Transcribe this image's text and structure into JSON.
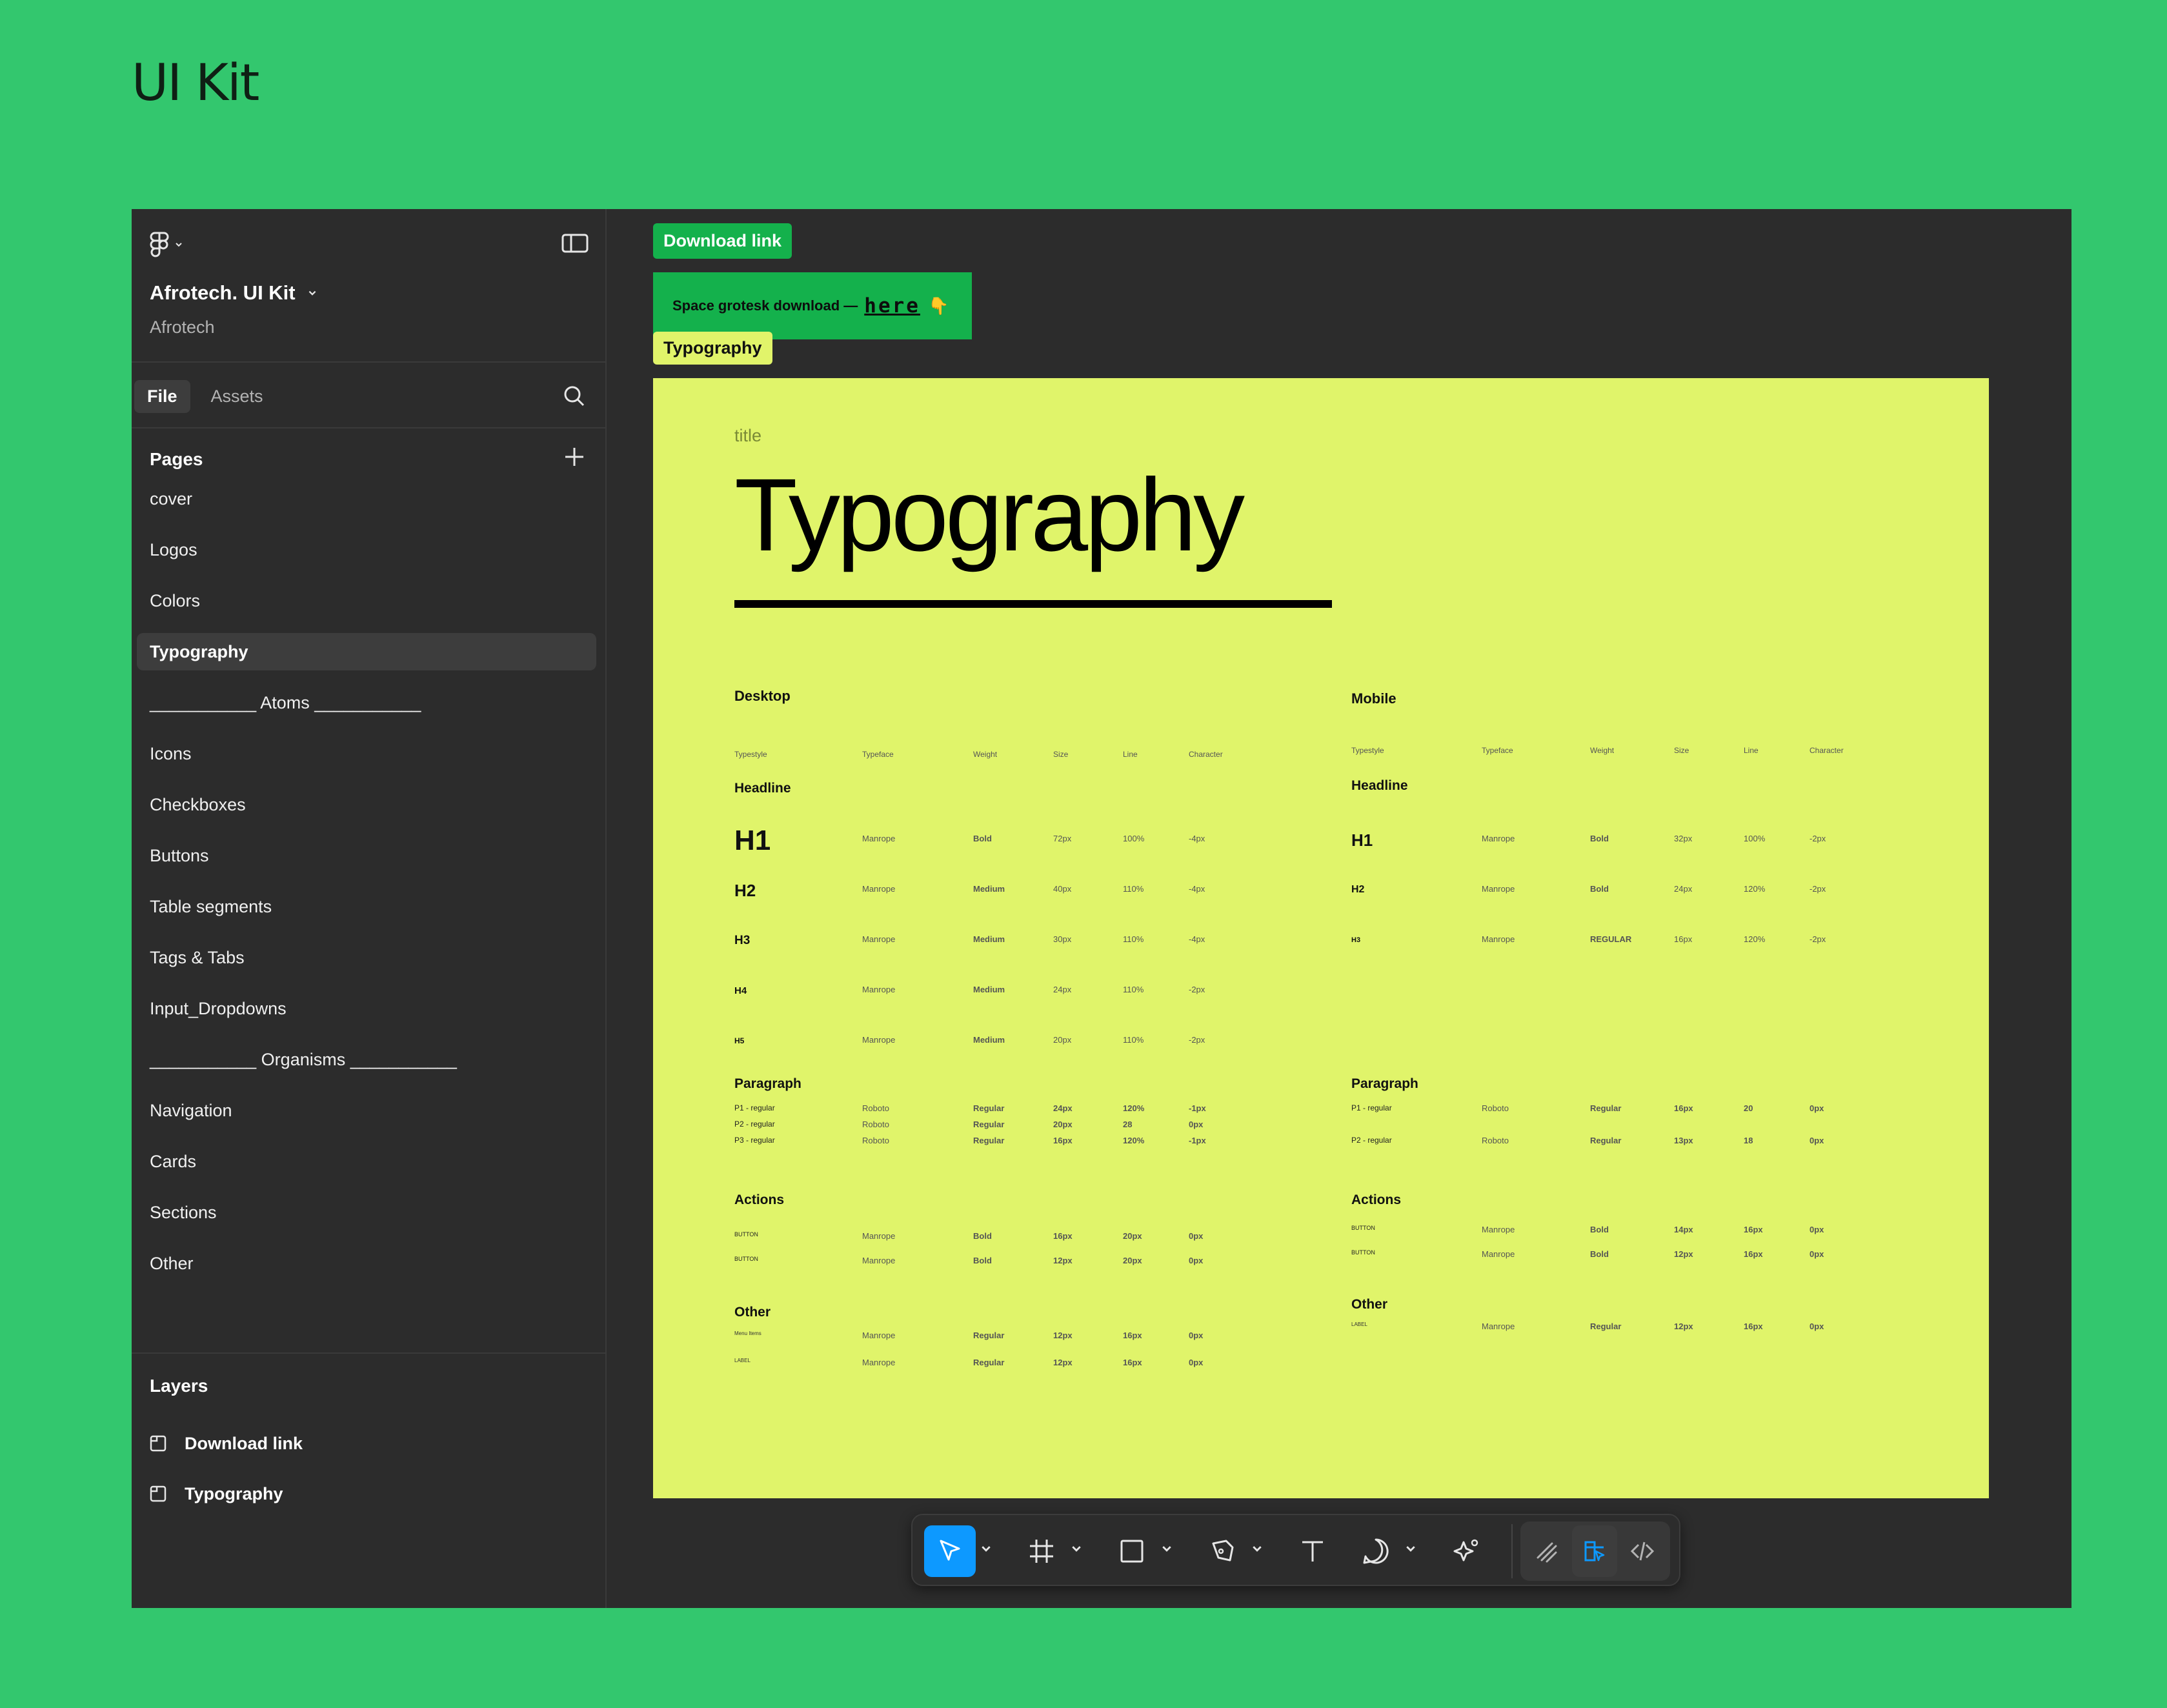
{
  "page_title": "UI Kit",
  "sidebar": {
    "file_name": "Afrotech. UI Kit",
    "team": "Afrotech",
    "tabs": [
      "File",
      "Assets"
    ],
    "pages_heading": "Pages",
    "pages": [
      "cover",
      "Logos",
      "Colors",
      "Typography",
      "___________ Atoms ___________",
      "Icons",
      "Checkboxes",
      "Buttons",
      "Table segments",
      "Tags & Tabs",
      "Input_Dropdowns",
      "___________ Organisms ___________",
      "Navigation",
      "Cards",
      "Sections",
      "Other"
    ],
    "active_page": "Typography",
    "layers_heading": "Layers",
    "layers": [
      "Download link",
      "Typography"
    ]
  },
  "canvas": {
    "download_tag": "Download link",
    "banner_text": "Space grotesk download —",
    "banner_link": "here",
    "banner_emoji": "👇",
    "typography_tag": "Typography"
  },
  "artboard": {
    "label": "title",
    "title": "Typography",
    "desktop": {
      "heading": "Desktop",
      "columns": [
        "Typestyle",
        "Typeface",
        "Weight",
        "Size",
        "Line",
        "Character"
      ],
      "headline_heading": "Headline",
      "headline_rows": [
        [
          "H1",
          "Manrope",
          "Bold",
          "72px",
          "100%",
          "-4px"
        ],
        [
          "H2",
          "Manrope",
          "Medium",
          "40px",
          "110%",
          "-4px"
        ],
        [
          "H3",
          "Manrope",
          "Medium",
          "30px",
          "110%",
          "-4px"
        ],
        [
          "H4",
          "Manrope",
          "Medium",
          "24px",
          "110%",
          "-2px"
        ],
        [
          "H5",
          "Manrope",
          "Medium",
          "20px",
          "110%",
          "-2px"
        ]
      ],
      "paragraph_heading": "Paragraph",
      "paragraph_rows": [
        [
          "P1 - regular",
          "Roboto",
          "Regular",
          "24px",
          "120%",
          "-1px"
        ],
        [
          "P2 - regular",
          "Roboto",
          "Regular",
          "20px",
          "28",
          "0px"
        ],
        [
          "P3 - regular",
          "Roboto",
          "Regular",
          "16px",
          "120%",
          "-1px"
        ]
      ],
      "actions_heading": "Actions",
      "actions_rows": [
        [
          "BUTTON",
          "Manrope",
          "Bold",
          "16px",
          "20px",
          "0px"
        ],
        [
          "BUTTON",
          "Manrope",
          "Bold",
          "12px",
          "20px",
          "0px"
        ]
      ],
      "other_heading": "Other",
      "other_rows": [
        [
          "Menu Items",
          "Manrope",
          "Regular",
          "12px",
          "16px",
          "0px"
        ],
        [
          "LABEL",
          "Manrope",
          "Regular",
          "12px",
          "16px",
          "0px"
        ]
      ]
    },
    "mobile": {
      "heading": "Mobile",
      "columns": [
        "Typestyle",
        "Typeface",
        "Weight",
        "Size",
        "Line",
        "Character"
      ],
      "headline_heading": "Headline",
      "headline_rows": [
        [
          "H1",
          "Manrope",
          "Bold",
          "32px",
          "100%",
          "-2px"
        ],
        [
          "H2",
          "Manrope",
          "Bold",
          "24px",
          "120%",
          "-2px"
        ],
        [
          "H3",
          "Manrope",
          "REGULAR",
          "16px",
          "120%",
          "-2px"
        ]
      ],
      "paragraph_heading": "Paragraph",
      "paragraph_rows": [
        [
          "P1 - regular",
          "Roboto",
          "Regular",
          "16px",
          "20",
          "0px"
        ],
        [
          "P2 - regular",
          "Roboto",
          "Regular",
          "13px",
          "18",
          "0px"
        ]
      ],
      "actions_heading": "Actions",
      "actions_rows": [
        [
          "BUTTON",
          "Manrope",
          "Bold",
          "14px",
          "16px",
          "0px"
        ],
        [
          "BUTTON",
          "Manrope",
          "Bold",
          "12px",
          "16px",
          "0px"
        ]
      ],
      "other_heading": "Other",
      "other_rows": [
        [
          "LABEL",
          "Manrope",
          "Regular",
          "12px",
          "16px",
          "0px"
        ]
      ]
    }
  },
  "toolbar": {
    "tools": [
      "move-tool",
      "frame-tool",
      "shape-tool",
      "pen-tool",
      "text-tool",
      "comment-tool",
      "actions-tool"
    ],
    "modes": [
      "draw-mode",
      "design-mode",
      "dev-mode"
    ],
    "active_tool": "move-tool",
    "active_mode": "design-mode"
  },
  "colors": {
    "background": "#33c76e",
    "artboard": "#e0f46a",
    "tag_green": "#14b14c",
    "active_blue": "#0d99ff"
  }
}
